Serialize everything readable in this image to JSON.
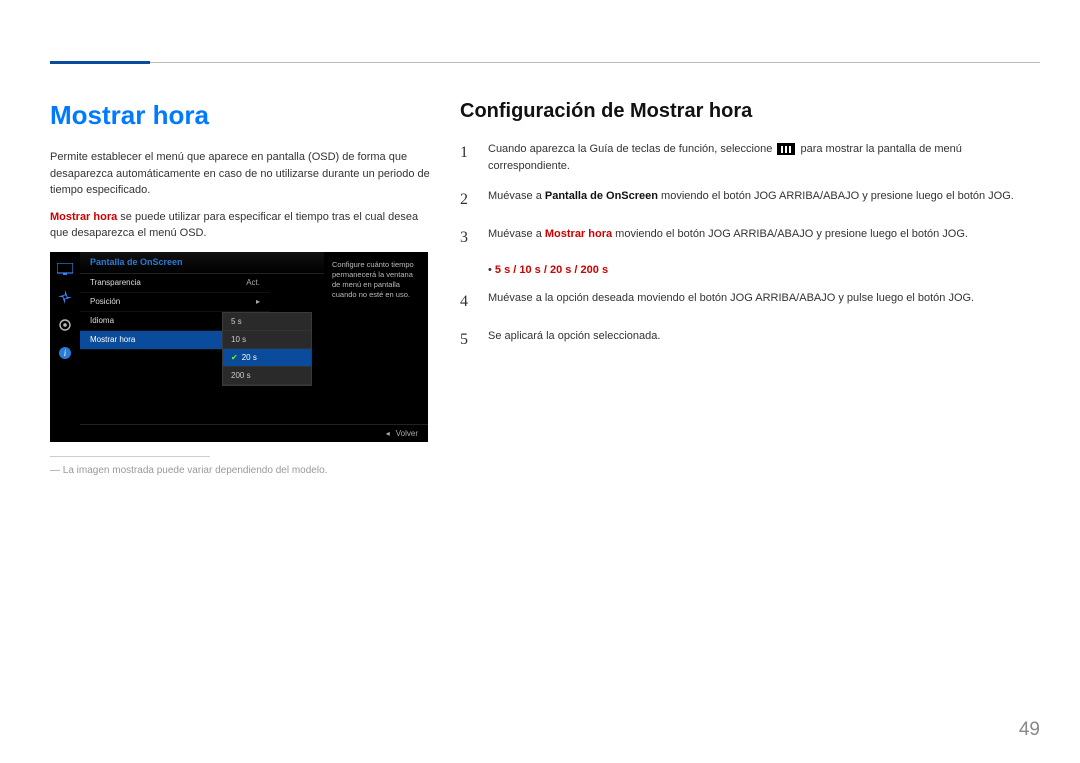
{
  "page_number": "49",
  "left": {
    "title": "Mostrar hora",
    "p1": "Permite establecer el menú que aparece en pantalla (OSD) de forma que desaparezca automáticamente en caso de no utilizarse durante un periodo de tiempo especificado.",
    "p2_bold": "Mostrar hora",
    "p2_rest": " se puede utilizar para especificar el tiempo tras el cual desea que desaparezca el menú OSD.",
    "footnote_prefix": "― ",
    "footnote": "La imagen mostrada puede variar dependiendo del modelo."
  },
  "osd": {
    "header": "Pantalla de OnScreen",
    "rows": [
      {
        "label": "Transparencia",
        "value": "Act."
      },
      {
        "label": "Posición",
        "value": "▸"
      },
      {
        "label": "Idioma",
        "value": ""
      },
      {
        "label": "Mostrar hora",
        "value": ""
      }
    ],
    "options": [
      "5 s",
      "10 s",
      "20 s",
      "200 s"
    ],
    "selected_option": "20 s",
    "desc": "Configure cuánto tiempo permanecerá la ventana de menú en pantalla cuando no esté en uso.",
    "footer_back_symbol": "◂",
    "footer_back": "Volver"
  },
  "right": {
    "title": "Configuración de Mostrar hora",
    "step1_a": "Cuando aparezca la Guía de teclas de función, seleccione ",
    "step1_b": " para mostrar la pantalla de menú correspondiente.",
    "step2_a": "Muévase a ",
    "step2_bold": "Pantalla de OnScreen",
    "step2_b": " moviendo el botón JOG ARRIBA/ABAJO y presione luego el botón JOG.",
    "step3_a": "Muévase a ",
    "step3_bold": "Mostrar hora",
    "step3_b": " moviendo el botón JOG ARRIBA/ABAJO y presione luego el botón JOG.",
    "bullet_prefix": "• ",
    "options_line": "5 s / 10 s / 20 s / 200 s",
    "step4": "Muévase a la opción deseada moviendo el botón JOG ARRIBA/ABAJO y pulse luego el botón JOG.",
    "step5": "Se aplicará la opción seleccionada."
  }
}
